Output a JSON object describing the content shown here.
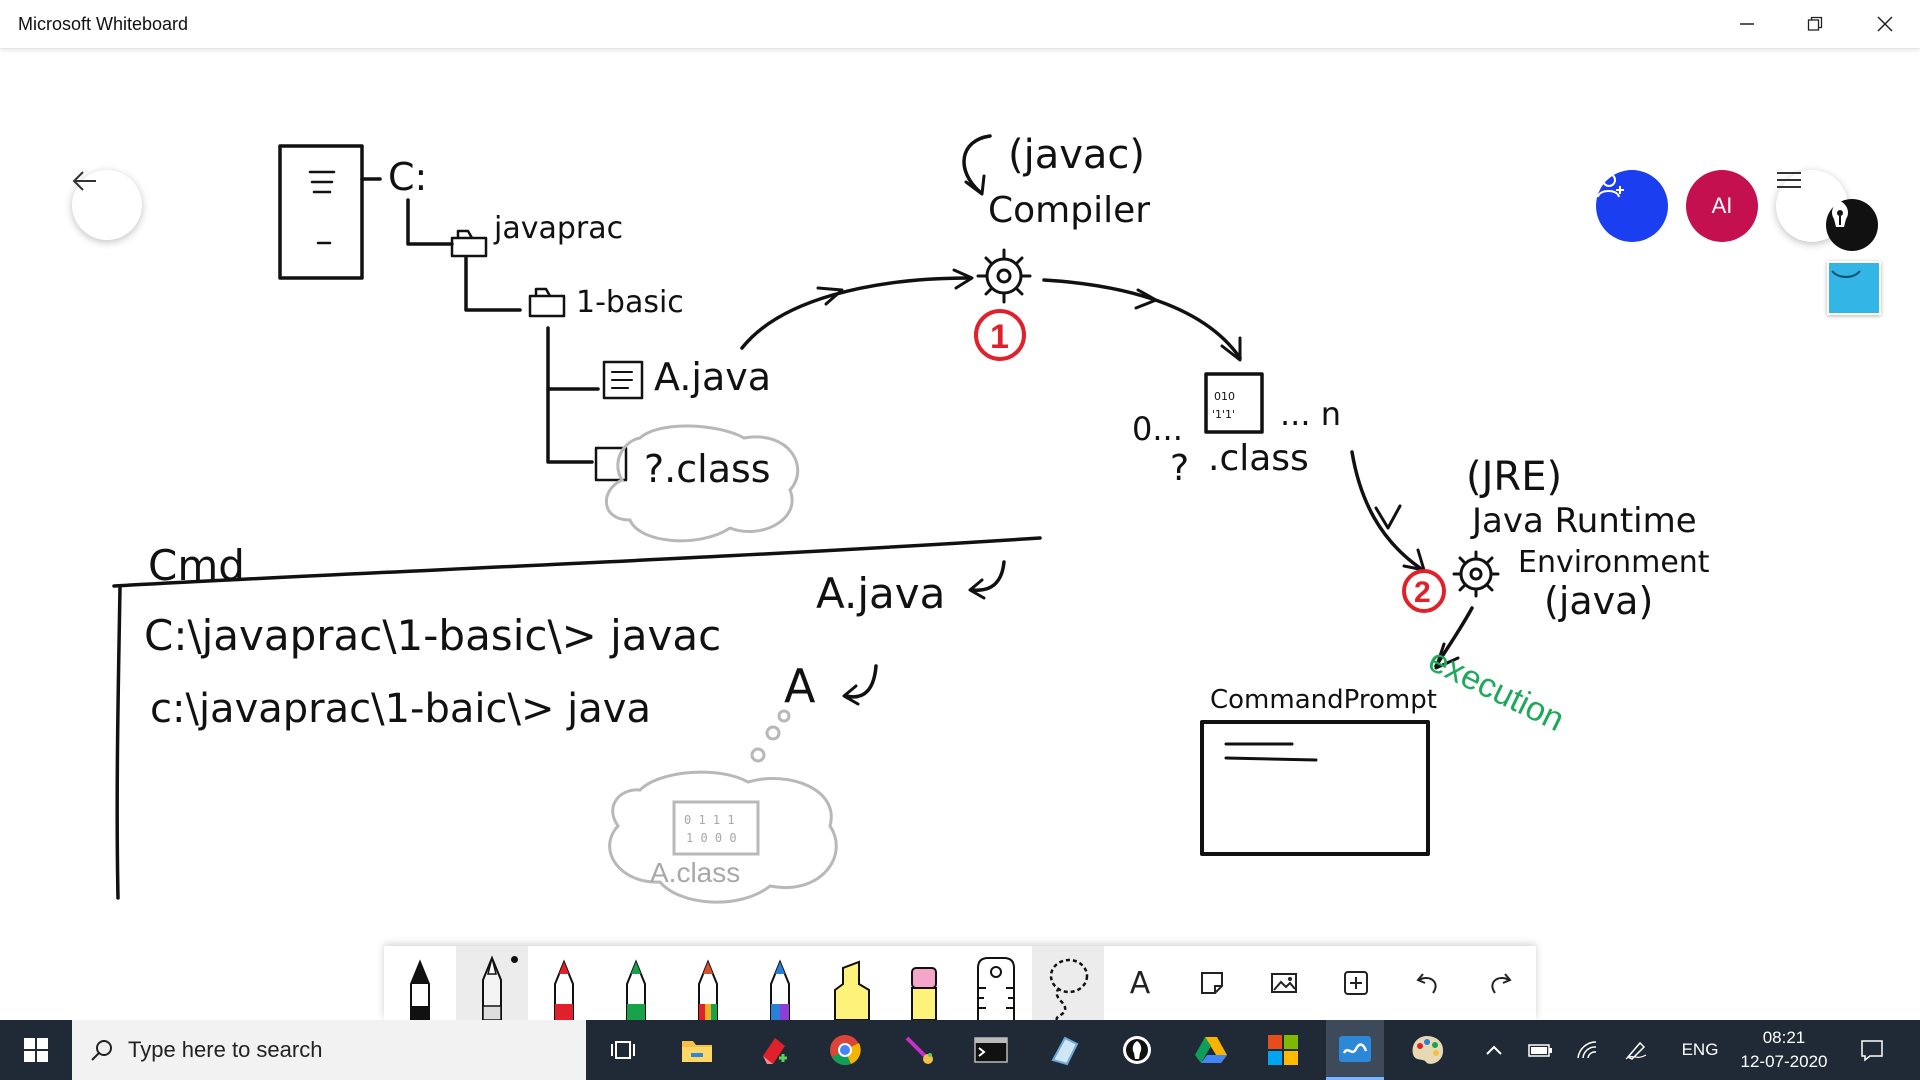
{
  "window": {
    "title": "Microsoft Whiteboard",
    "minimize_icon": "minimize-icon",
    "maximize_icon": "restore-icon",
    "close_icon": "close-icon"
  },
  "canvas_controls": {
    "back_icon": "arrow-left-icon",
    "invite_icon": "add-person-icon",
    "avatar_initials": "AI",
    "menu_icon": "hamburger-menu-icon",
    "pen_badge_icon": "pen-nib-icon",
    "sticky_icon": "sticky-note-icon",
    "invite_color": "#1a3ef0",
    "avatar_color": "#c4104f"
  },
  "ink": {
    "drive": "C:",
    "folder1": "javaprac",
    "folder2": "1-basic",
    "file_java": "A.java",
    "file_class": "?.class",
    "compiler_paren": "(javac)",
    "compiler": "Compiler",
    "step1": "1",
    "class_range_start": "0...",
    "class_range_end": "... n",
    "class_q": "?",
    "class_label": ".class",
    "jre_paren": "(JRE)",
    "jre_line1": "Java Runtime",
    "jre_line2": "Environment",
    "jre_java": "(java)",
    "step2": "2",
    "command_prompt": "CommandPrompt",
    "execution": "execution",
    "cmd": "Cmd",
    "cmd_line1": "C:\\javaprac\\1-basic\\> javac",
    "cmd_line1_arg": "A.java",
    "cmd_line2": "c:\\javaprac\\1-baic\\> java",
    "cmd_line2_arg": "A",
    "cloud_class": "A.class"
  },
  "ink_colors": {
    "black": "#111111",
    "red": "#e0202a",
    "green": "#1ea85a",
    "grey": "#a8a8a8"
  },
  "tools": [
    {
      "name": "pen-black",
      "color": "#111111"
    },
    {
      "name": "pen-white",
      "color": "#ffffff",
      "selected": true
    },
    {
      "name": "pen-red",
      "color": "#e0202a"
    },
    {
      "name": "pen-green",
      "color": "#18a24a"
    },
    {
      "name": "pen-rainbow",
      "color": "#d94f2b"
    },
    {
      "name": "pen-galaxy",
      "color": "#2a7fd6"
    },
    {
      "name": "highlighter-yellow",
      "color": "#fff27a"
    },
    {
      "name": "eraser",
      "color": "#f3a6c8"
    },
    {
      "name": "ruler",
      "icon": "ruler-icon"
    },
    {
      "name": "lasso",
      "icon": "lasso-icon"
    },
    {
      "name": "text",
      "icon": "text-icon",
      "label": "A"
    },
    {
      "name": "note",
      "icon": "note-icon"
    },
    {
      "name": "image",
      "icon": "image-icon"
    },
    {
      "name": "insert",
      "icon": "plus-box-icon"
    },
    {
      "name": "undo",
      "icon": "undo-icon"
    },
    {
      "name": "redo",
      "icon": "redo-icon"
    }
  ],
  "taskbar": {
    "search_placeholder": "Type here to search",
    "apps": [
      "task-view-icon",
      "file-explorer-icon",
      "windows-paint-3d-icon",
      "chrome-icon",
      "paint-brush-icon",
      "terminal-icon",
      "onenote-icon",
      "pen-app-icon",
      "google-drive-icon",
      "office-icon",
      "whiteboard-icon",
      "paint-palette-icon"
    ],
    "tray": {
      "language": "ENG",
      "time": "08:21",
      "date": "12-07-2020"
    }
  }
}
